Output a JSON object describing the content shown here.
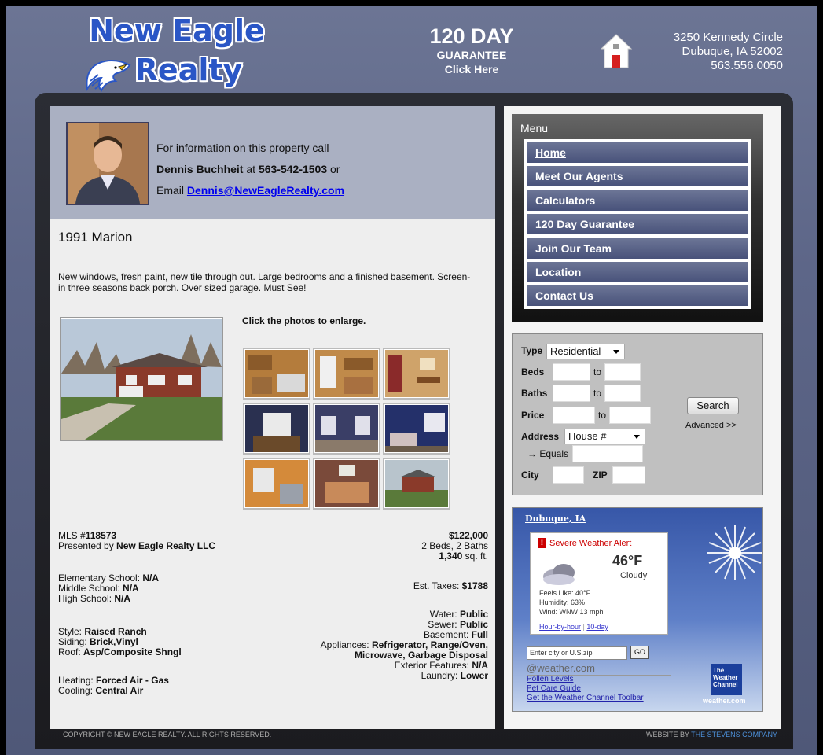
{
  "header": {
    "logo_line1": "New Eagle",
    "logo_line2": "Realty",
    "guarantee_big": "120 DAY",
    "guarantee_mid": "GUARANTEE",
    "guarantee_cta": "Click Here",
    "address_line1": "3250 Kennedy Circle",
    "address_line2": "Dubuque, IA 52002",
    "phone": "563.556.0050"
  },
  "agent": {
    "intro": "For information on this property call",
    "name": "Dennis Buchheit",
    "at": " at ",
    "phone": "563-542-1503",
    "or": " or",
    "email_label": "Email ",
    "email": "Dennis@NewEagleRealty.com"
  },
  "property": {
    "title": "1991 Marion",
    "description": "New windows, fresh paint, new tile through out. Large bedrooms and a finished basement. Screen-in three seasons back porch. Over sized garage. Must See!",
    "photo_note": "Click the photos to enlarge."
  },
  "details": {
    "mls_label": "MLS #",
    "mls": "118573",
    "presented_label": "Presented by ",
    "presented": "New Eagle Realty LLC",
    "price": "$122,000",
    "beds_baths": "2 Beds, 2 Baths",
    "sqft": "1,340",
    "sqft_unit": " sq. ft.",
    "elem_label": "Elementary School: ",
    "elem": "N/A",
    "middle_label": "Middle School: ",
    "middle": "N/A",
    "high_label": "High School: ",
    "high": "N/A",
    "taxes_label": "Est. Taxes: ",
    "taxes": "$1788",
    "style_label": "Style: ",
    "style": "Raised Ranch",
    "siding_label": "Siding: ",
    "siding": "Brick,Vinyl",
    "roof_label": "Roof: ",
    "roof": "Asp/Composite Shngl",
    "water_label": "Water: ",
    "water": "Public",
    "sewer_label": "Sewer: ",
    "sewer": "Public",
    "basement_label": "Basement: ",
    "basement": "Full",
    "appliances_label": "Appliances: ",
    "appliances_1": "Refrigerator, Range/Oven,",
    "appliances_2": "Microwave, Garbage Disposal",
    "heating_label": "Heating: ",
    "heating": "Forced Air - Gas",
    "cooling_label": "Cooling: ",
    "cooling": "Central Air",
    "exterior_label": "Exterior Features: ",
    "exterior": "N/A",
    "laundry_label": "Laundry: ",
    "laundry": "Lower"
  },
  "menu": {
    "title": "Menu",
    "items": [
      {
        "label": "Home"
      },
      {
        "label": "Meet Our Agents"
      },
      {
        "label": "Calculators"
      },
      {
        "label": "120 Day Guarantee"
      },
      {
        "label": "Join Our Team"
      },
      {
        "label": "Location"
      },
      {
        "label": "Contact Us"
      }
    ]
  },
  "search": {
    "type_label": "Type",
    "type_value": "Residential",
    "beds_label": "Beds",
    "baths_label": "Baths",
    "price_label": "Price",
    "to": "to",
    "address_label": "Address",
    "address_value": "House #",
    "equals_label": "→ Equals",
    "city_label": "City",
    "zip_label": "ZIP",
    "button": "Search",
    "advanced": "Advanced >>"
  },
  "weather": {
    "city": "Dubuque, IA",
    "alert": "Severe Weather Alert",
    "temp": "46°F",
    "condition": "Cloudy",
    "feels": "Feels Like: 40°F",
    "humidity": "Humidity: 63%",
    "wind": "Wind: WNW 13 mph",
    "hourly": "Hour-by-hour",
    "sep": " | ",
    "tenday": "10-day",
    "input_placeholder": "Enter city or U.S.zip",
    "go": "GO",
    "brand": "@weather.com",
    "link1": "Pollen Levels",
    "link2": "Pet Care Guide",
    "link3": "Get the Weather Channel Toolbar",
    "logo_text": "The Weather Channel",
    "site": "weather.com"
  },
  "footer": {
    "copyright": "COPYRIGHT © NEW EAGLE REALTY. ALL RIGHTS RESERVED.",
    "credit_prefix": "WEBSITE BY ",
    "credit_link": "THE STEVENS COMPANY"
  },
  "colors": {
    "header_bg": "#5d6688",
    "menu_item": "#4e587e",
    "link": "#0000ee"
  }
}
